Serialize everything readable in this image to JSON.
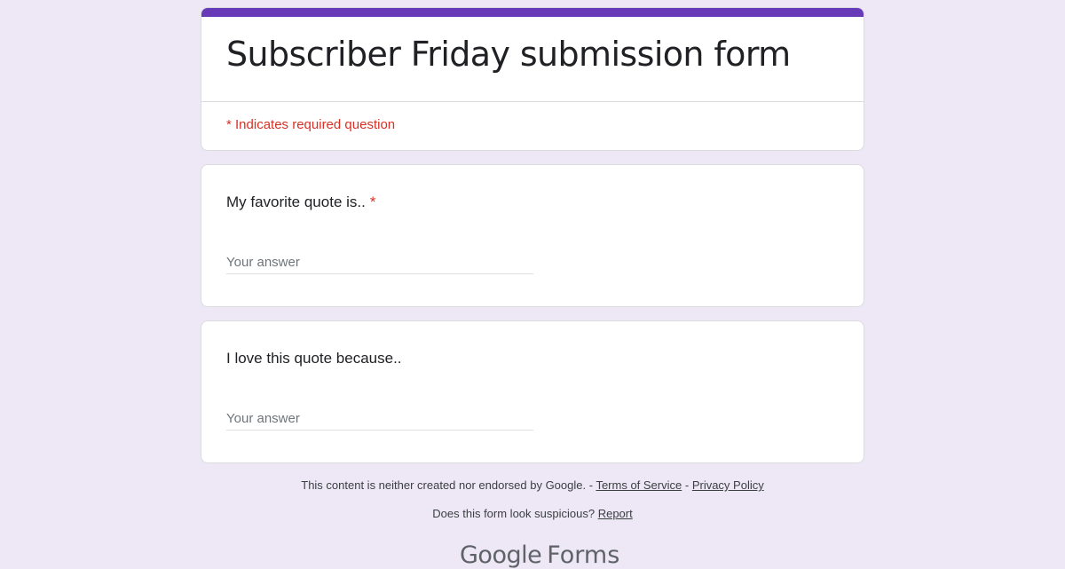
{
  "form": {
    "title": "Subscriber Friday submission form",
    "required_note": "* Indicates required question",
    "accent_color": "#673ab7",
    "background_color": "#ede7f6"
  },
  "questions": [
    {
      "label": "My favorite quote is..",
      "required_marker": "*",
      "placeholder": "Your answer",
      "value": ""
    },
    {
      "label": "I love this quote because..",
      "required_marker": "",
      "placeholder": "Your answer",
      "value": ""
    }
  ],
  "footer": {
    "disclaimer": "This content is neither created nor endorsed by Google.",
    "sep1": " - ",
    "terms_label": "Terms of Service",
    "sep2": " - ",
    "privacy_label": "Privacy Policy",
    "suspicious_text": "Does this form look suspicious?",
    "report_label": "Report"
  },
  "brand": {
    "google": "Google",
    "forms": "Forms"
  }
}
